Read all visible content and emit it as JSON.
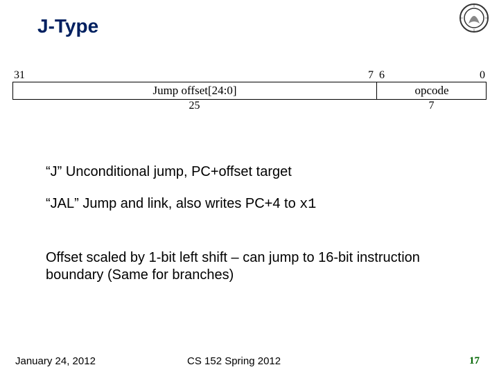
{
  "title": "J-Type",
  "diagram": {
    "bit_hi_left": "31",
    "bit_hi_right": "7",
    "bit_lo_left": "6",
    "bit_lo_right": "0",
    "field_main": "Jump offset[24:0]",
    "field_opcode": "opcode",
    "width_main": "25",
    "width_opcode": "7"
  },
  "lines": {
    "j": "“J” Unconditional jump, PC+offset target",
    "jal_pre": "“JAL” Jump and link, also writes PC+4 to ",
    "jal_reg": "x1",
    "offset": "Offset scaled by 1‑bit left shift – can jump to 16‑bit instruction boundary (Same for branches)"
  },
  "footer": {
    "date": "January 24, 2012",
    "course": "CS 152 Spring 2012",
    "page": "17"
  }
}
